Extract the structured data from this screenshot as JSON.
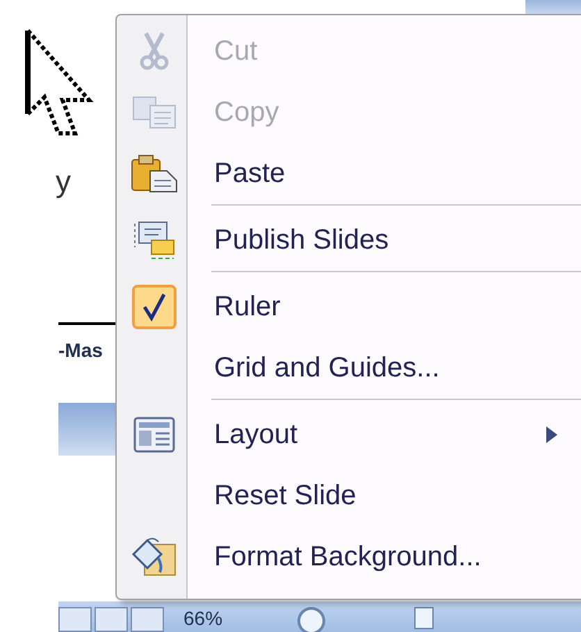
{
  "document": {
    "fragment": "y",
    "heading": "-Mas"
  },
  "status_bar": {
    "zoom": "66%"
  },
  "context_menu": {
    "items": [
      {
        "kind": "item",
        "label": "Cut",
        "disabled": true,
        "checked": false,
        "submenu": false
      },
      {
        "kind": "item",
        "label": "Copy",
        "disabled": true,
        "checked": false,
        "submenu": false
      },
      {
        "kind": "item",
        "label": "Paste",
        "disabled": false,
        "checked": false,
        "submenu": false
      },
      {
        "kind": "separator"
      },
      {
        "kind": "item",
        "label": "Publish Slides",
        "disabled": false,
        "checked": false,
        "submenu": false
      },
      {
        "kind": "separator"
      },
      {
        "kind": "item",
        "label": "Ruler",
        "disabled": false,
        "checked": true,
        "submenu": false
      },
      {
        "kind": "item",
        "label": "Grid and Guides...",
        "disabled": false,
        "checked": false,
        "submenu": false
      },
      {
        "kind": "separator"
      },
      {
        "kind": "item",
        "label": "Layout",
        "disabled": false,
        "checked": false,
        "submenu": true
      },
      {
        "kind": "item",
        "label": "Reset Slide",
        "disabled": false,
        "checked": false,
        "submenu": false
      },
      {
        "kind": "item",
        "label": "Format Background...",
        "disabled": false,
        "checked": false,
        "submenu": false
      }
    ]
  }
}
